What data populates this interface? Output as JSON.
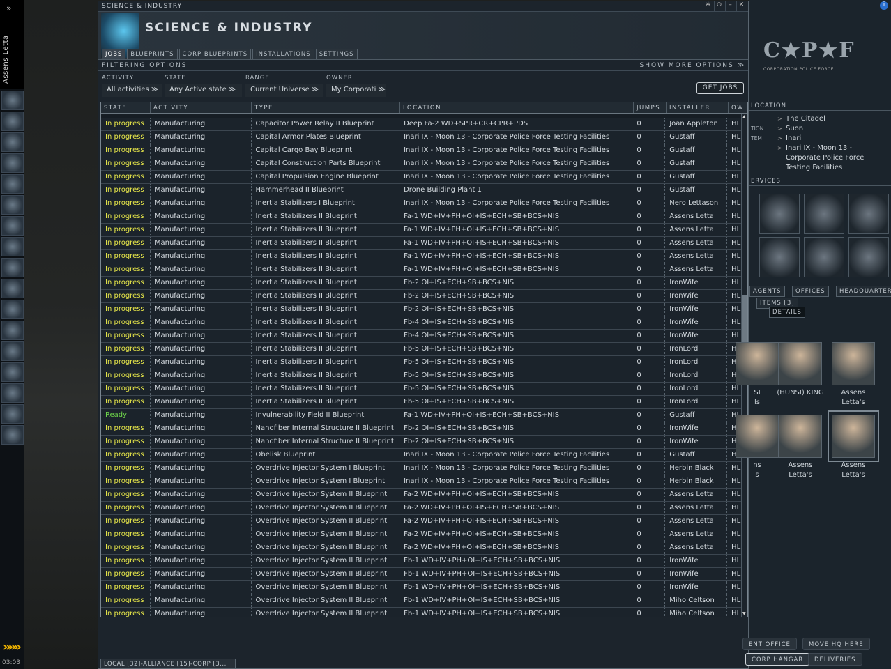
{
  "neocom": {
    "expand": "»",
    "pilot": "Assens Letta",
    "clock": "03:03",
    "arrow": "»»»"
  },
  "window": {
    "titlebar": "SCIENCE & INDUSTRY",
    "title": "SCIENCE & INDUSTRY",
    "tabs": [
      "JOBS",
      "BLUEPRINTS",
      "CORP BLUEPRINTS",
      "INSTALLATIONS",
      "SETTINGS"
    ],
    "filtering": "FILTERING OPTIONS",
    "show_more": "SHOW MORE OPTIONS ≫",
    "filters": {
      "activity": {
        "label": "ACTIVITY",
        "value": "All activities"
      },
      "state": {
        "label": "STATE",
        "value": "Any Active state"
      },
      "range": {
        "label": "RANGE",
        "value": "Current Universe"
      },
      "owner": {
        "label": "OWNER",
        "value": "My Corporati"
      }
    },
    "get_jobs": "GET JOBS",
    "columns": [
      "STATE",
      "ACTIVITY",
      "TYPE",
      "LOCATION",
      "JUMPS",
      "INSTALLER",
      "OWN"
    ],
    "rows": [
      [
        "In progress",
        "Manufacturing",
        "Capacitor Power Relay II Blueprint",
        "Deep Fa-2 WD+SPR+CR+CPR+PDS",
        "0",
        "Joan Appleton",
        "HL"
      ],
      [
        "In progress",
        "Manufacturing",
        "Capital Armor Plates Blueprint",
        "Inari IX - Moon 13 - Corporate Police Force Testing Facilities",
        "0",
        "Gustaff",
        "HL"
      ],
      [
        "In progress",
        "Manufacturing",
        "Capital Cargo Bay Blueprint",
        "Inari IX - Moon 13 - Corporate Police Force Testing Facilities",
        "0",
        "Gustaff",
        "HL"
      ],
      [
        "In progress",
        "Manufacturing",
        "Capital Construction Parts Blueprint",
        "Inari IX - Moon 13 - Corporate Police Force Testing Facilities",
        "0",
        "Gustaff",
        "HL"
      ],
      [
        "In progress",
        "Manufacturing",
        "Capital Propulsion Engine Blueprint",
        "Inari IX - Moon 13 - Corporate Police Force Testing Facilities",
        "0",
        "Gustaff",
        "HL"
      ],
      [
        "In progress",
        "Manufacturing",
        "Hammerhead II Blueprint",
        "Drone Building Plant 1",
        "0",
        "Gustaff",
        "HL"
      ],
      [
        "In progress",
        "Manufacturing",
        "Inertia Stabilizers I Blueprint",
        "Inari IX - Moon 13 - Corporate Police Force Testing Facilities",
        "0",
        "Nero Lettason",
        "HL"
      ],
      [
        "In progress",
        "Manufacturing",
        "Inertia Stabilizers II Blueprint",
        "Fa-1 WD+IV+PH+OI+IS+ECH+SB+BCS+NIS",
        "0",
        "Assens Letta",
        "HL"
      ],
      [
        "In progress",
        "Manufacturing",
        "Inertia Stabilizers II Blueprint",
        "Fa-1 WD+IV+PH+OI+IS+ECH+SB+BCS+NIS",
        "0",
        "Assens Letta",
        "HL"
      ],
      [
        "In progress",
        "Manufacturing",
        "Inertia Stabilizers II Blueprint",
        "Fa-1 WD+IV+PH+OI+IS+ECH+SB+BCS+NIS",
        "0",
        "Assens Letta",
        "HL"
      ],
      [
        "In progress",
        "Manufacturing",
        "Inertia Stabilizers II Blueprint",
        "Fa-1 WD+IV+PH+OI+IS+ECH+SB+BCS+NIS",
        "0",
        "Assens Letta",
        "HL"
      ],
      [
        "In progress",
        "Manufacturing",
        "Inertia Stabilizers II Blueprint",
        "Fa-1 WD+IV+PH+OI+IS+ECH+SB+BCS+NIS",
        "0",
        "Assens Letta",
        "HL"
      ],
      [
        "In progress",
        "Manufacturing",
        "Inertia Stabilizers II Blueprint",
        "Fb-2 OI+IS+ECH+SB+BCS+NIS",
        "0",
        "IronWife",
        "HL"
      ],
      [
        "In progress",
        "Manufacturing",
        "Inertia Stabilizers II Blueprint",
        "Fb-2 OI+IS+ECH+SB+BCS+NIS",
        "0",
        "IronWife",
        "HL"
      ],
      [
        "In progress",
        "Manufacturing",
        "Inertia Stabilizers II Blueprint",
        "Fb-2 OI+IS+ECH+SB+BCS+NIS",
        "0",
        "IronWife",
        "HL"
      ],
      [
        "In progress",
        "Manufacturing",
        "Inertia Stabilizers II Blueprint",
        "Fb-4 OI+IS+ECH+SB+BCS+NIS",
        "0",
        "IronWife",
        "HL"
      ],
      [
        "In progress",
        "Manufacturing",
        "Inertia Stabilizers II Blueprint",
        "Fb-4 OI+IS+ECH+SB+BCS+NIS",
        "0",
        "IronWife",
        "HL"
      ],
      [
        "In progress",
        "Manufacturing",
        "Inertia Stabilizers II Blueprint",
        "Fb-5 OI+IS+ECH+SB+BCS+NIS",
        "0",
        "IronLord",
        "HL"
      ],
      [
        "In progress",
        "Manufacturing",
        "Inertia Stabilizers II Blueprint",
        "Fb-5 OI+IS+ECH+SB+BCS+NIS",
        "0",
        "IronLord",
        "HL"
      ],
      [
        "In progress",
        "Manufacturing",
        "Inertia Stabilizers II Blueprint",
        "Fb-5 OI+IS+ECH+SB+BCS+NIS",
        "0",
        "IronLord",
        "HL"
      ],
      [
        "In progress",
        "Manufacturing",
        "Inertia Stabilizers II Blueprint",
        "Fb-5 OI+IS+ECH+SB+BCS+NIS",
        "0",
        "IronLord",
        "HL"
      ],
      [
        "In progress",
        "Manufacturing",
        "Inertia Stabilizers II Blueprint",
        "Fb-5 OI+IS+ECH+SB+BCS+NIS",
        "0",
        "IronLord",
        "HL"
      ],
      [
        "Ready",
        "Manufacturing",
        "Invulnerability Field II Blueprint",
        "Fa-1 WD+IV+PH+OI+IS+ECH+SB+BCS+NIS",
        "0",
        "Gustaff",
        "HL"
      ],
      [
        "In progress",
        "Manufacturing",
        "Nanofiber Internal Structure II Blueprint",
        "Fb-2 OI+IS+ECH+SB+BCS+NIS",
        "0",
        "IronWife",
        "HL"
      ],
      [
        "In progress",
        "Manufacturing",
        "Nanofiber Internal Structure II Blueprint",
        "Fb-2 OI+IS+ECH+SB+BCS+NIS",
        "0",
        "IronWife",
        "HL"
      ],
      [
        "In progress",
        "Manufacturing",
        "Obelisk Blueprint",
        "Inari IX - Moon 13 - Corporate Police Force Testing Facilities",
        "0",
        "Gustaff",
        "HL"
      ],
      [
        "In progress",
        "Manufacturing",
        "Overdrive Injector System I Blueprint",
        "Inari IX - Moon 13 - Corporate Police Force Testing Facilities",
        "0",
        "Herbin Black",
        "HL"
      ],
      [
        "In progress",
        "Manufacturing",
        "Overdrive Injector System I Blueprint",
        "Inari IX - Moon 13 - Corporate Police Force Testing Facilities",
        "0",
        "Herbin Black",
        "HL"
      ],
      [
        "In progress",
        "Manufacturing",
        "Overdrive Injector System II Blueprint",
        "Fa-2 WD+IV+PH+OI+IS+ECH+SB+BCS+NIS",
        "0",
        "Assens Letta",
        "HL"
      ],
      [
        "In progress",
        "Manufacturing",
        "Overdrive Injector System II Blueprint",
        "Fa-2 WD+IV+PH+OI+IS+ECH+SB+BCS+NIS",
        "0",
        "Assens Letta",
        "HL"
      ],
      [
        "In progress",
        "Manufacturing",
        "Overdrive Injector System II Blueprint",
        "Fa-2 WD+IV+PH+OI+IS+ECH+SB+BCS+NIS",
        "0",
        "Assens Letta",
        "HL"
      ],
      [
        "In progress",
        "Manufacturing",
        "Overdrive Injector System II Blueprint",
        "Fa-2 WD+IV+PH+OI+IS+ECH+SB+BCS+NIS",
        "0",
        "Assens Letta",
        "HL"
      ],
      [
        "In progress",
        "Manufacturing",
        "Overdrive Injector System II Blueprint",
        "Fa-2 WD+IV+PH+OI+IS+ECH+SB+BCS+NIS",
        "0",
        "Assens Letta",
        "HL"
      ],
      [
        "In progress",
        "Manufacturing",
        "Overdrive Injector System II Blueprint",
        "Fb-1 WD+IV+PH+OI+IS+ECH+SB+BCS+NIS",
        "0",
        "IronWife",
        "HL"
      ],
      [
        "In progress",
        "Manufacturing",
        "Overdrive Injector System II Blueprint",
        "Fb-1 WD+IV+PH+OI+IS+ECH+SB+BCS+NIS",
        "0",
        "IronWife",
        "HL"
      ],
      [
        "In progress",
        "Manufacturing",
        "Overdrive Injector System II Blueprint",
        "Fb-1 WD+IV+PH+OI+IS+ECH+SB+BCS+NIS",
        "0",
        "IronWife",
        "HL"
      ],
      [
        "In progress",
        "Manufacturing",
        "Overdrive Injector System II Blueprint",
        "Fb-1 WD+IV+PH+OI+IS+ECH+SB+BCS+NIS",
        "0",
        "Miho Celtson",
        "HL"
      ],
      [
        "In progress",
        "Manufacturing",
        "Overdrive Injector System II Blueprint",
        "Fb-1 WD+IV+PH+OI+IS+ECH+SB+BCS+NIS",
        "0",
        "Miho Celtson",
        "HL"
      ]
    ],
    "chat": "LOCAL [32]-ALLIANCE [15]-CORP [3..."
  },
  "station": {
    "logo": "C★P★F",
    "logo_sub": "CORPORATION POLICE FORCE",
    "location_header": "LOCATION",
    "location": [
      {
        "k": "",
        "v": "The Citadel"
      },
      {
        "k": "TION",
        "v": "Suon"
      },
      {
        "k": "TEM",
        "v": "Inari"
      },
      {
        "k": "",
        "v": "Inari IX - Moon 13 -"
      },
      {
        "k": "",
        "v": "Corporate Police Force"
      },
      {
        "k": "",
        "v": "Testing Facilities"
      }
    ],
    "services_header": "ERVICES",
    "tabs": [
      "AGENTS",
      "OFFICES",
      "HEADQUARTERS"
    ],
    "items_tab": "ITEMS [3]",
    "tooltip": "DETAILS",
    "ships": [
      {
        "l1": "SI",
        "l2": "ls"
      },
      {
        "l1": "(HUNSI) KING",
        "l2": ""
      },
      {
        "l1": "Assens",
        "l2": "Letta's"
      },
      {
        "l1": "ns",
        "l2": "s"
      },
      {
        "l1": "Assens",
        "l2": "Letta's"
      },
      {
        "l1": "Assens",
        "l2": "Letta's"
      }
    ],
    "buttons": [
      "ENT OFFICE",
      "MOVE HQ HERE",
      "CORP HANGAR",
      "DELIVERIES"
    ]
  },
  "colors": {
    "in_progress": "#e6e64a",
    "ready": "#6ed64a"
  }
}
